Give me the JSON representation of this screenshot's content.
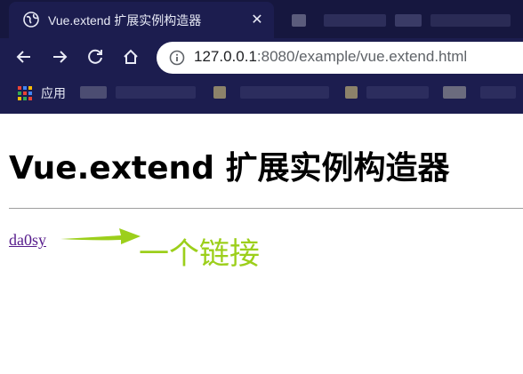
{
  "browser": {
    "tab": {
      "title": "Vue.extend 扩展实例构造器",
      "close_symbol": "✕"
    },
    "address": {
      "host": "127.0.0.1",
      "rest": ":8080/example/vue.extend.html"
    },
    "bookmarks": {
      "apps_label": "应用"
    }
  },
  "page": {
    "title": "Vue.extend 扩展实例构造器",
    "link_text": "da0sy",
    "annotation": "一个链接"
  },
  "colors": {
    "chrome_dark": "#1c1d4f",
    "link_visited": "#551a8b",
    "annotation_green": "#9ccf1b"
  }
}
